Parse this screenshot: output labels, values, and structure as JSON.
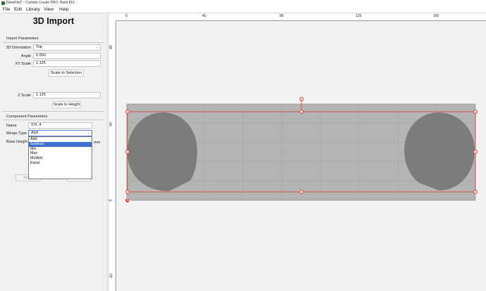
{
  "window": {
    "title": "[NewFile]* - Carbide Create PRO, Build 815"
  },
  "menu": [
    {
      "label": "File",
      "name": "menu-file"
    },
    {
      "label": "Edit",
      "name": "menu-edit"
    },
    {
      "label": "Library",
      "name": "menu-library"
    },
    {
      "label": "View",
      "name": "menu-view"
    },
    {
      "label": "Help",
      "name": "menu-help"
    }
  ],
  "panel": {
    "title": "3D Import",
    "import_section": "Import Parameters",
    "orientation_label": "3D Orientation",
    "orientation_value": "Top",
    "angle_label": "Angle",
    "angle_value": "0.000",
    "xy_scale_label": "XY Scale",
    "xy_scale_value": "1.125",
    "scale_to_selection_label": "Scale to Selection",
    "z_scale_label": "Z Scale",
    "z_scale_value": "1.125",
    "scale_to_height_label": "Scale to Height",
    "component_section": "Component Parameters",
    "name_label": "Name",
    "name_value": "STL 4",
    "merge_type_label": "Merge Type",
    "merge_type_value": "Add",
    "merge_options": [
      "Add",
      "Subtract",
      "Min",
      "Max",
      "Multiply",
      "Equal"
    ],
    "merge_highlighted": "Subtract",
    "base_height_label": "Base Height",
    "base_height_unit": "mm",
    "apply_label": "Apply",
    "done_label": "Done"
  },
  "rulers": {
    "top": [
      "0",
      "40",
      "80",
      "120",
      "160"
    ],
    "left": [
      "80",
      "40",
      "0",
      "-40"
    ]
  },
  "colors": {
    "selection": "#e04a3a",
    "model_fill": "#b4b4b4",
    "model_dark": "#7c7c7c",
    "dropdown_highlight": "#3d6fcc"
  }
}
